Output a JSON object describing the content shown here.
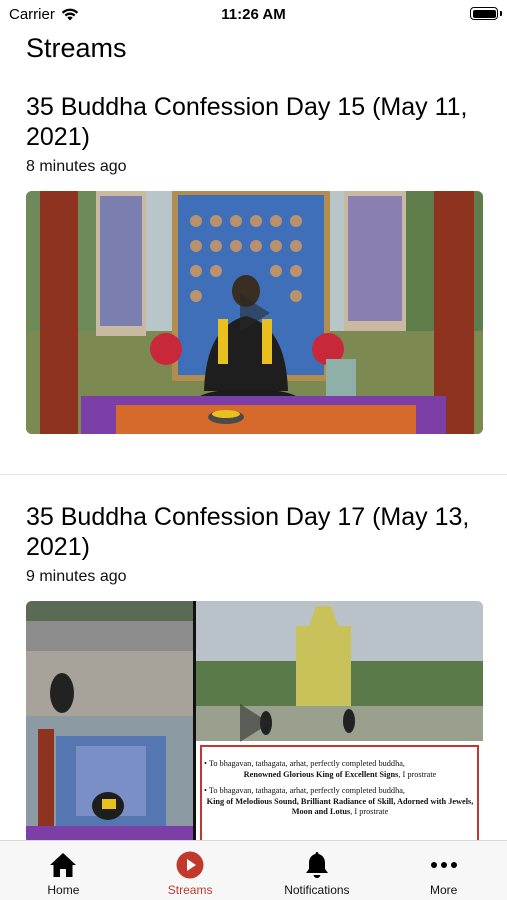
{
  "status_bar": {
    "carrier": "Carrier",
    "time": "11:26 AM"
  },
  "page": {
    "title": "Streams"
  },
  "streams": [
    {
      "title": "35 Buddha Confession Day 15 (May 11, 2021)",
      "time_ago": "8 minutes ago"
    },
    {
      "title": "35 Buddha Confession Day 17 (May 13, 2021)",
      "time_ago": "9 minutes ago",
      "slide_lines": [
        {
          "prefix": "• To bhagavan, tathagata, arhat, perfectly completed buddha,",
          "bold": "Renowned Glorious King of Excellent Signs",
          "suffix": ", I prostrate"
        },
        {
          "prefix": "• To bhagavan, tathagata, arhat, perfectly completed buddha,",
          "bold": "King of Melodious Sound, Brilliant Radiance of Skill, Adorned with Jewels, Moon and Lotus",
          "suffix": ", I prostrate"
        }
      ]
    }
  ],
  "tabs": [
    {
      "label": "Home",
      "icon": "home-icon",
      "active": false
    },
    {
      "label": "Streams",
      "icon": "play-circle-icon",
      "active": true
    },
    {
      "label": "Notifications",
      "icon": "bell-icon",
      "active": false
    },
    {
      "label": "More",
      "icon": "more-icon",
      "active": false
    }
  ],
  "colors": {
    "accent": "#c0392b",
    "tab_bar_bg": "#f7f7f7",
    "text": "#000000"
  }
}
